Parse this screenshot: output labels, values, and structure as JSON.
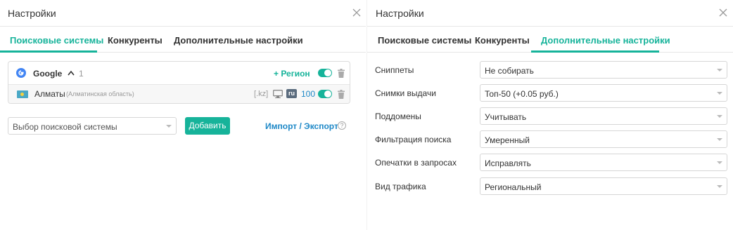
{
  "left": {
    "title": "Настройки",
    "tabs": [
      {
        "label": "Поисковые системы",
        "active": true
      },
      {
        "label": "Конкуренты",
        "active": false
      },
      {
        "label": "Дополнительные настройки",
        "active": false
      }
    ],
    "engine": {
      "icon": "google-icon",
      "name": "Google",
      "count": "1",
      "add_region_label": "+ Регион",
      "enabled": true
    },
    "region": {
      "flag": "kz-flag",
      "name": "Алматы",
      "sub": "(Алматинская область)",
      "domain": "[.kz]",
      "device_icon": "desktop-icon",
      "lang": "ru",
      "depth": "100",
      "enabled": true
    },
    "engine_select_placeholder": "Выбор поисковой системы",
    "add_button": "Добавить",
    "import_label": "Импорт",
    "separator": "/",
    "export_label": "Экспорт",
    "help": "?"
  },
  "right": {
    "title": "Настройки",
    "tabs": [
      {
        "label": "Поисковые системы",
        "active": false
      },
      {
        "label": "Конкуренты",
        "active": false
      },
      {
        "label": "Дополнительные настройки",
        "active": true
      }
    ],
    "settings": [
      {
        "label": "Сниппеты",
        "value": "Не собирать"
      },
      {
        "label": "Снимки выдачи",
        "value": "Топ-50 (+0.05 руб.)"
      },
      {
        "label": "Поддомены",
        "value": "Учитывать"
      },
      {
        "label": "Фильтрация поиска",
        "value": "Умеренный"
      },
      {
        "label": "Опечатки в запросах",
        "value": "Исправлять"
      },
      {
        "label": "Вид трафика",
        "value": "Региональный"
      }
    ]
  },
  "colors": {
    "accent": "#16b39a",
    "link": "#1e88c7"
  }
}
